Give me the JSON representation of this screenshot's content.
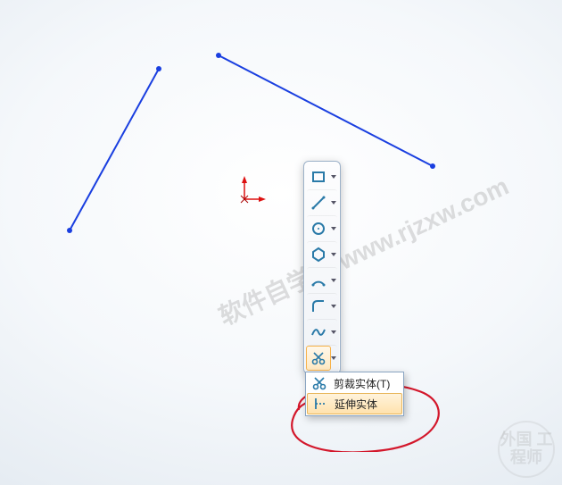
{
  "toolbar": {
    "buttons": [
      {
        "name": "rectangle-tool"
      },
      {
        "name": "line-tool"
      },
      {
        "name": "circle-tool"
      },
      {
        "name": "polygon-tool"
      },
      {
        "name": "arc-tool"
      },
      {
        "name": "fillet-tool"
      },
      {
        "name": "spline-tool"
      },
      {
        "name": "trim-tool"
      }
    ]
  },
  "flyout": {
    "trim_label": "剪裁实体(T)",
    "extend_label": "延伸实体"
  },
  "watermark": {
    "main": "软件自学网 www.rjzxw.com",
    "corner": "外国\n工程师"
  }
}
